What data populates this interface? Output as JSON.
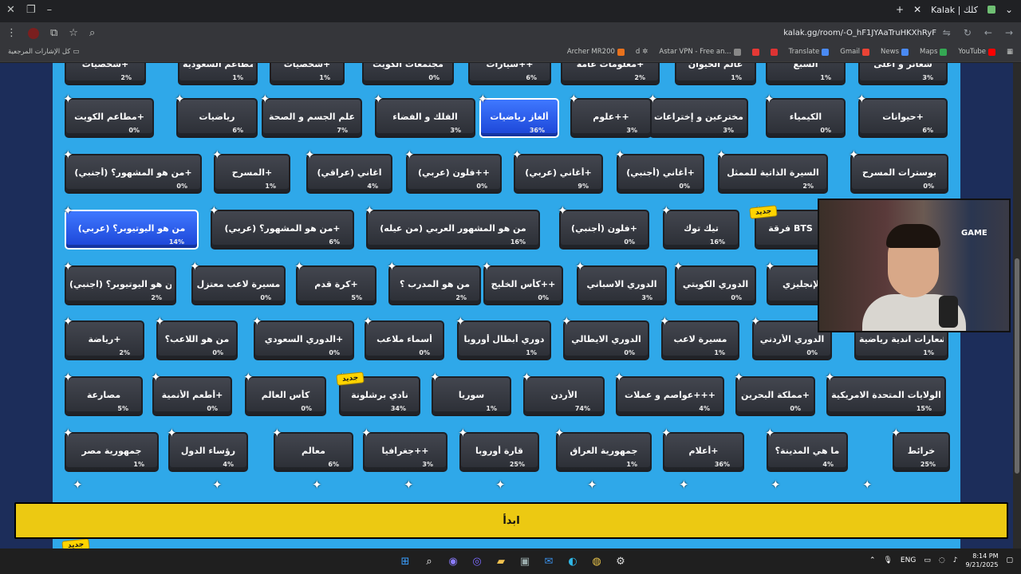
{
  "browser": {
    "tab_title": "Kalak | كلك",
    "url": "kalak.gg/room/-O_hF1JYAaTruHKXhRyF",
    "bookmarks_folder": "كل الإشارات المرجعية",
    "bookmarks": [
      "Archer MR200",
      "d",
      "Astar VPN - Free an...",
      "Translate",
      "Gmail",
      "News",
      "Maps",
      "YouTube"
    ]
  },
  "categories_row0": [
    {
      "label": "شعائر و أعلى",
      "pct": "3%"
    },
    {
      "label": "السبع",
      "pct": "1%"
    },
    {
      "label": "عالم الحيوان",
      "pct": "1%"
    },
    {
      "label": "معلومات عامة+",
      "pct": "2%"
    },
    {
      "label": "سيارات++",
      "pct": "6%"
    },
    {
      "label": "مجتمعات الكويت",
      "pct": "0%"
    },
    {
      "label": "شخصيات+",
      "pct": "1%"
    },
    {
      "label": "مطاعم السعودية",
      "pct": "1%"
    },
    {
      "label": "شخصيات+",
      "pct": "2%"
    }
  ],
  "categories_row1": [
    {
      "label": "حيوانات+",
      "pct": "6%"
    },
    {
      "label": "الكيمياء",
      "pct": "0%"
    },
    {
      "label": "مخترعين و إختراعات",
      "pct": "3%"
    },
    {
      "label": "علوم++",
      "pct": "3%"
    },
    {
      "label": "ألغاز رياضيات",
      "pct": "36%"
    },
    {
      "label": "الفلك و الفضاء",
      "pct": "3%"
    },
    {
      "label": "علم الجسم و الصحة",
      "pct": "7%"
    },
    {
      "label": "رياضيات",
      "pct": "6%"
    },
    {
      "label": "مطاعم الكويت+",
      "pct": "0%"
    }
  ],
  "categories_row2": [
    {
      "label": "بوسترات المسرح",
      "pct": "0%"
    },
    {
      "label": "السيرة الذاتية للممثل",
      "pct": "2%"
    },
    {
      "label": "أغاني (أجنبي)+",
      "pct": "0%"
    },
    {
      "label": "أغاني (عربي)+",
      "pct": "9%"
    },
    {
      "label": "فلون (عربي)++",
      "pct": "0%"
    },
    {
      "label": "اغاني (عراقي)",
      "pct": "4%"
    },
    {
      "label": "المسرح+",
      "pct": "1%"
    },
    {
      "label": "من هو المشهور؟ (أجنبي)+",
      "pct": "0%"
    }
  ],
  "categories_row3": [
    {
      "label": "فرقة BTS",
      "pct": ""
    },
    {
      "label": "تيك توك",
      "pct": "16%"
    },
    {
      "label": "فلون (أجنبي)+",
      "pct": "0%"
    },
    {
      "label": "من هو المشهور العربي (من عيله)",
      "pct": "16%"
    },
    {
      "label": "من هو المشهور؟ (عربي)+",
      "pct": "6%"
    },
    {
      "label": "من هو اليوتيوبر؟ (عربي)",
      "pct": "14%"
    }
  ],
  "categories_row4": [
    {
      "label": "الإنجليزي",
      "pct": ""
    },
    {
      "label": "الدوري الكويتي",
      "pct": "0%"
    },
    {
      "label": "الدوري الاسباني",
      "pct": "3%"
    },
    {
      "label": "كأس الخليج++",
      "pct": "0%"
    },
    {
      "label": "من هو المدرب ؟",
      "pct": "2%"
    },
    {
      "label": "كرة قدم+",
      "pct": "5%"
    },
    {
      "label": "مسيرة لاعب معتزل",
      "pct": "0%"
    },
    {
      "label": "من هو اليوتيوبر؟ (اجنبي)",
      "pct": "2%"
    }
  ],
  "categories_row5": [
    {
      "label": "شعارات اندية رياضية",
      "pct": "1%"
    },
    {
      "label": "الدوري الأردني",
      "pct": "0%"
    },
    {
      "label": "مسيرة لاعب",
      "pct": "1%"
    },
    {
      "label": "الدوري الايطالي",
      "pct": "0%"
    },
    {
      "label": "دوري أبطال أوروبا",
      "pct": "1%"
    },
    {
      "label": "أسماء ملاعب",
      "pct": "0%"
    },
    {
      "label": "الدوري السعودي+",
      "pct": "0%"
    },
    {
      "label": "من هو اللاعب؟",
      "pct": "0%"
    },
    {
      "label": "رياضة+",
      "pct": "2%"
    }
  ],
  "categories_row6": [
    {
      "label": "الولايات المتحدة الامريكية",
      "pct": "15%"
    },
    {
      "label": "مملكة البحرين+",
      "pct": "0%"
    },
    {
      "label": "عواصم و عملات+++",
      "pct": "4%"
    },
    {
      "label": "الأردن",
      "pct": "74%"
    },
    {
      "label": "سوريا",
      "pct": "1%"
    },
    {
      "label": "نادي برشلونة",
      "pct": "34%"
    },
    {
      "label": "كأس العالم",
      "pct": "0%"
    },
    {
      "label": "أطعم الأنمية+",
      "pct": "0%"
    },
    {
      "label": "مصارعة",
      "pct": "5%"
    }
  ],
  "categories_row7": [
    {
      "label": "خرائط",
      "pct": "25%"
    },
    {
      "label": "ما هي المدينة؟",
      "pct": "4%"
    },
    {
      "label": "أعلام+",
      "pct": "36%"
    },
    {
      "label": "جمهورية العراق",
      "pct": "1%"
    },
    {
      "label": "قارة أوروبا",
      "pct": "25%"
    },
    {
      "label": "جغرافيا++",
      "pct": "3%"
    },
    {
      "label": "معالم",
      "pct": "6%"
    },
    {
      "label": "رؤساء الدول",
      "pct": "4%"
    },
    {
      "label": "جمهورية مصر",
      "pct": "1%"
    }
  ],
  "new_badge": "جديد",
  "webcam_sign": "GAME",
  "start_button": "ابدأ",
  "taskbar": {
    "lang": "ENG",
    "time": "8:14 PM",
    "date": "9/21/2025"
  }
}
